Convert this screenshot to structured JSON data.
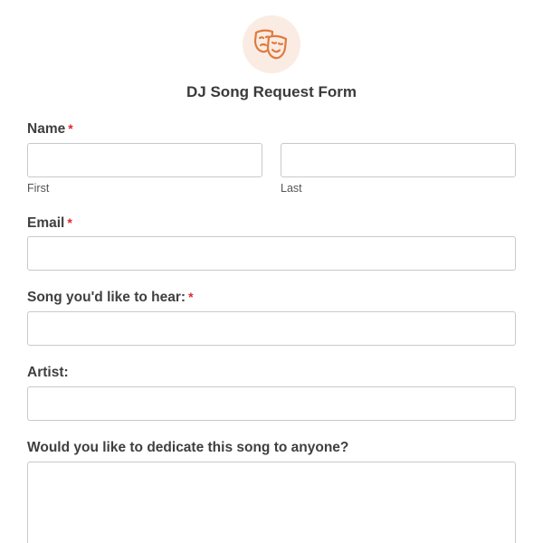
{
  "form": {
    "title": "DJ Song Request Form",
    "logo_icon": "theater-masks-icon",
    "accent_color": "#e07a3f",
    "logo_background": "#fbece3",
    "required_marker": "*",
    "required_color": "#e0282e"
  },
  "fields": {
    "name": {
      "label": "Name",
      "required": true,
      "first_sublabel": "First",
      "last_sublabel": "Last",
      "first_value": "",
      "last_value": ""
    },
    "email": {
      "label": "Email",
      "required": true,
      "value": ""
    },
    "song": {
      "label": "Song you'd like to hear:",
      "required": true,
      "value": ""
    },
    "artist": {
      "label": "Artist:",
      "required": false,
      "value": ""
    },
    "dedication": {
      "label": "Would you like to dedicate this song to anyone?",
      "required": false,
      "value": ""
    }
  }
}
